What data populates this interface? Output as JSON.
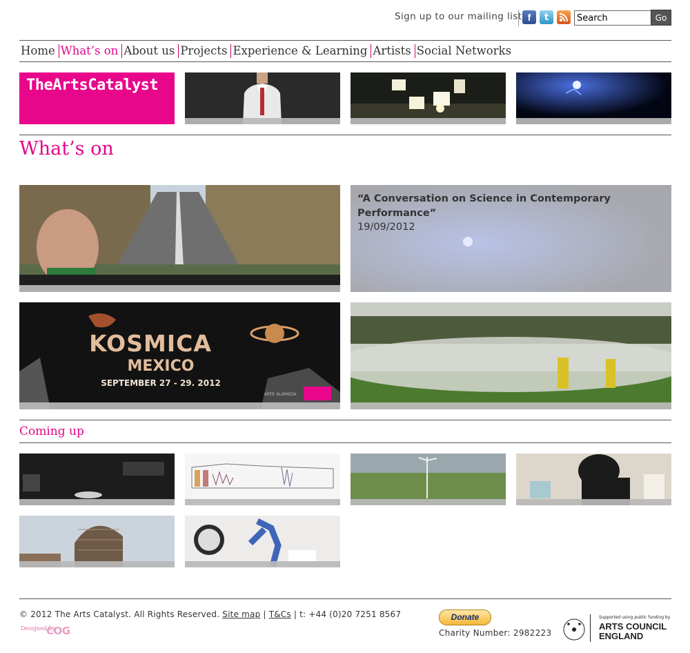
{
  "utility": {
    "mailing_label": "Sign up to our mailing list",
    "search_value": "Search",
    "go_label": "Go",
    "icons": [
      "facebook-icon",
      "twitter-icon",
      "rss-icon"
    ]
  },
  "nav": {
    "items": [
      {
        "label": "Home"
      },
      {
        "label": "What’s on",
        "active": true
      },
      {
        "label": "About us"
      },
      {
        "label": "Projects"
      },
      {
        "label": "Experience & Learning"
      },
      {
        "label": "Artists"
      },
      {
        "label": "Social Networks"
      }
    ]
  },
  "brand": {
    "logo_text": "TheArtsCatalyst"
  },
  "page": {
    "title": "What’s on"
  },
  "featured": [
    {
      "title": "",
      "date": ""
    },
    {
      "title": "“A Conversation on Science in Contemporary Performance”",
      "date": "19/09/2012"
    },
    {
      "title": "",
      "date": ""
    },
    {
      "title": "",
      "date": ""
    }
  ],
  "kosmica": {
    "title": "KOSMICA",
    "subtitle": "MEXICO",
    "dates": "SEPTEMBER 27 - 29. 2012",
    "partner": "ARTE ALAMEDA"
  },
  "coming_up": {
    "heading": "Coming up"
  },
  "footer": {
    "copyright": "© 2012 The Arts Catalyst. All Rights Reserved.",
    "sitemap": "Site map",
    "sep1": "|",
    "tandc": "T&Cs",
    "phone": "| t: +44 (0)20 7251 8567",
    "designed_by": "Designed by",
    "designer": "COG",
    "donate": "Donate",
    "charity": "Charity Number: 2982223",
    "ace_support": "Supported using public funding by",
    "ace_line1": "ARTS COUNCIL",
    "ace_line2": "ENGLAND",
    "ace_seal": "ARTS COUNCIL ENGLAND"
  },
  "colors": {
    "accent": "#e0058a",
    "logo_bg": "#e8078b",
    "tile_bar": "#bebebe"
  }
}
